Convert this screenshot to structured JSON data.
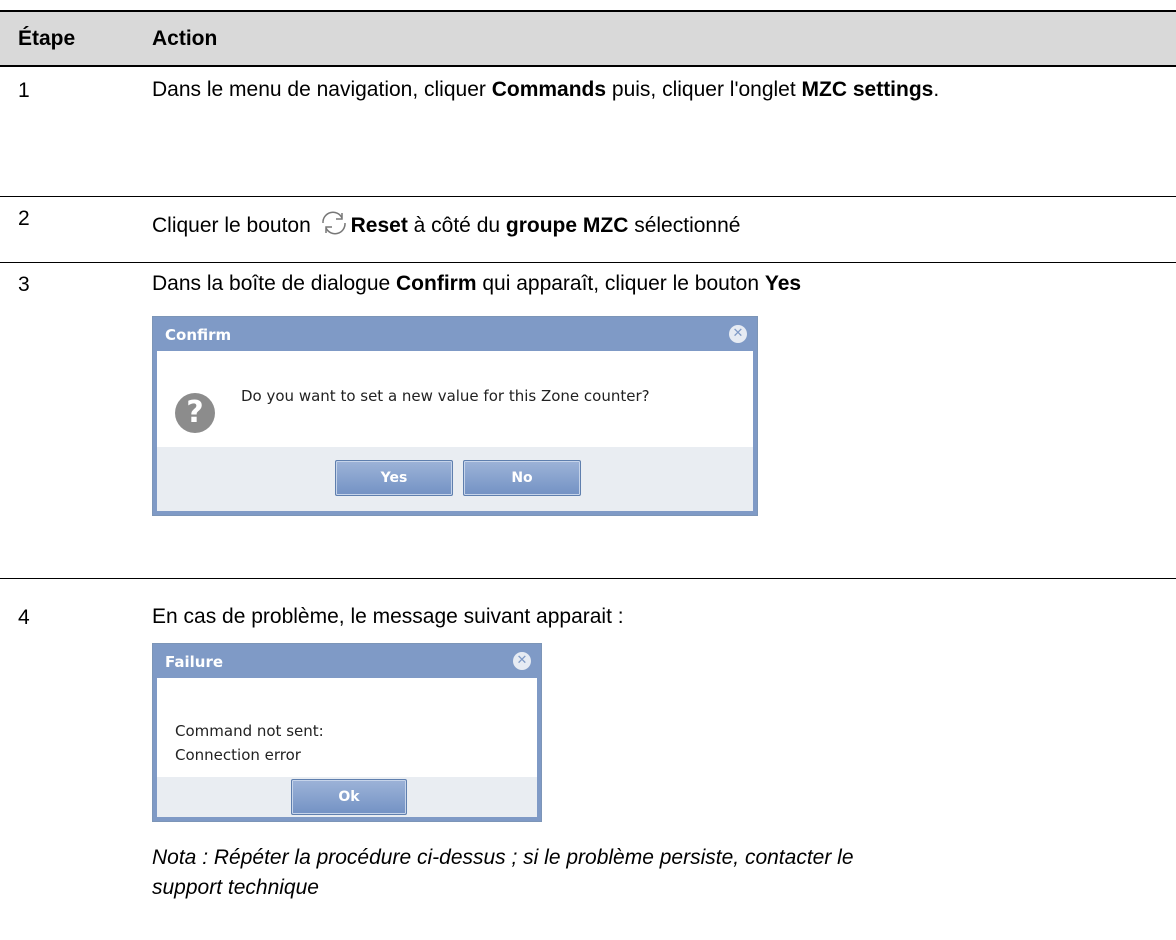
{
  "header": {
    "col_step": "Étape",
    "col_action": "Action"
  },
  "steps": [
    {
      "num": "1",
      "pre": "Dans le menu de navigation, cliquer ",
      "b1": "Commands",
      "mid": " puis, cliquer l'onglet ",
      "b2": "MZC settings",
      "post": "."
    },
    {
      "num": "2",
      "pre": "Cliquer le bouton ",
      "b1": "Reset",
      "mid": " à côté du ",
      "b2": "groupe MZC",
      "post": " sélectionné"
    },
    {
      "num": "3",
      "pre": "Dans la boîte de dialogue ",
      "b1": "Confirm",
      "mid": " qui apparaît, cliquer le bouton ",
      "b2": "Yes"
    },
    {
      "num": "4",
      "text": "En cas de problème, le message suivant apparait :"
    }
  ],
  "confirm_dialog": {
    "title": "Confirm",
    "message": "Do you want to set a new value for this Zone counter?",
    "yes_label": "Yes",
    "no_label": "No"
  },
  "failure_dialog": {
    "title": "Failure",
    "line1": "Command not sent:",
    "line2": "Connection error",
    "ok_label": "Ok"
  },
  "nota": "Nota : Répéter la procédure ci-dessus ; si le problème persiste, contacter le support technique",
  "colors": {
    "header_bg": "#d9d9d9",
    "dialog_title": "#7f9ac6",
    "button": "#7f9ac6"
  },
  "icons": [
    "refresh-icon",
    "question-icon",
    "close-icon"
  ]
}
